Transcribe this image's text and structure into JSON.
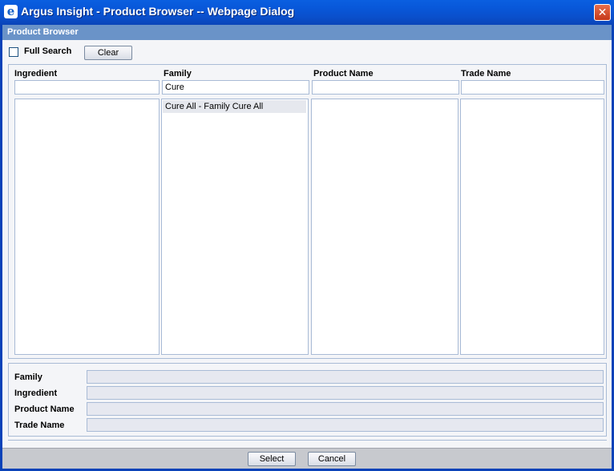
{
  "window": {
    "title": "Argus Insight - Product Browser -- Webpage Dialog",
    "app_icon": "ie-icon",
    "close_glyph": "✕"
  },
  "header": {
    "title": "Product Browser"
  },
  "toolbar": {
    "full_search_label": "Full Search",
    "full_search_checked": false,
    "clear_label": "Clear"
  },
  "columns": [
    {
      "label": "Ingredient",
      "filter": "",
      "items": []
    },
    {
      "label": "Family",
      "filter": "Cure",
      "items": [
        "Cure All - Family Cure All"
      ]
    },
    {
      "label": "Product Name",
      "filter": "",
      "items": []
    },
    {
      "label": "Trade Name",
      "filter": "",
      "items": []
    }
  ],
  "selection": {
    "family_label": "Family",
    "family_value": "",
    "ingredient_label": "Ingredient",
    "ingredient_value": "",
    "product_name_label": "Product Name",
    "product_name_value": "",
    "trade_name_label": "Trade Name",
    "trade_name_value": ""
  },
  "footer": {
    "select_label": "Select",
    "cancel_label": "Cancel"
  }
}
